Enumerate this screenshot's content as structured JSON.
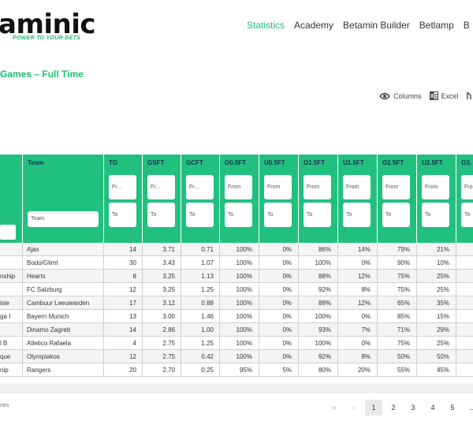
{
  "header": {
    "logo_text": "aminic",
    "tagline": "POWER TO YOUR BETS",
    "nav": [
      "Statistics",
      "Academy",
      "Betamin Builder",
      "Betlamp",
      "B"
    ],
    "active_nav": "Statistics"
  },
  "subtitle": "Games – Full Time",
  "tools": {
    "columns_label": "Columns",
    "excel_label": "Excel"
  },
  "table": {
    "columns": [
      "Team",
      "TG",
      "GSFT",
      "GCFT",
      "O0.5FT",
      "U0.5FT",
      "O1.5FT",
      "U1.5FT",
      "O2.5FT",
      "U2.5FT",
      "O3."
    ],
    "filter_from": "Fr...",
    "filter_from_full": "From",
    "filter_to": "To",
    "team_filter_placeholder": "Team",
    "rows": [
      {
        "league": "",
        "team": "Ajax",
        "tg": "14",
        "gsft": "3.71",
        "gcft": "0.71",
        "o05": "100%",
        "u05": "0%",
        "o15": "86%",
        "u15": "14%",
        "o25": "79%",
        "u25": "21%"
      },
      {
        "league": "",
        "team": "Bodo/Glimt",
        "tg": "30",
        "gsft": "3.43",
        "gcft": "1.07",
        "o05": "100%",
        "u05": "0%",
        "o15": "100%",
        "u15": "0%",
        "o25": "90%",
        "u25": "10%"
      },
      {
        "league": "nship",
        "team": "Hearts",
        "tg": "8",
        "gsft": "3.25",
        "gcft": "1.13",
        "o05": "100%",
        "u05": "0%",
        "o15": "88%",
        "u15": "12%",
        "o25": "75%",
        "u25": "25%"
      },
      {
        "league": "",
        "team": "FC Salzburg",
        "tg": "12",
        "gsft": "3.25",
        "gcft": "1.25",
        "o05": "100%",
        "u05": "0%",
        "o15": "92%",
        "u15": "8%",
        "o25": "75%",
        "u25": "25%"
      },
      {
        "league": "isie",
        "team": "Cambuur Leeuwarden",
        "tg": "17",
        "gsft": "3.12",
        "gcft": "0.88",
        "o05": "100%",
        "u05": "0%",
        "o15": "88%",
        "u15": "12%",
        "o25": "65%",
        "u25": "35%"
      },
      {
        "league": "ga I",
        "team": "Bayern Munich",
        "tg": "13",
        "gsft": "3.00",
        "gcft": "1.46",
        "o05": "100%",
        "u05": "0%",
        "o15": "100%",
        "u15": "0%",
        "o25": "85%",
        "u25": "15%"
      },
      {
        "league": "",
        "team": "Dinamo Zagreb",
        "tg": "14",
        "gsft": "2.86",
        "gcft": "1.00",
        "o05": "100%",
        "u05": "0%",
        "o15": "93%",
        "u15": "7%",
        "o25": "71%",
        "u25": "29%"
      },
      {
        "league": "l B",
        "team": "Atletico Rafaela",
        "tg": "4",
        "gsft": "2.75",
        "gcft": "1.25",
        "o05": "100%",
        "u05": "0%",
        "o15": "100%",
        "u15": "0%",
        "o25": "75%",
        "u25": "25%"
      },
      {
        "league": "que",
        "team": "Olympiakos",
        "tg": "12",
        "gsft": "2.75",
        "gcft": "0.42",
        "o05": "100%",
        "u05": "0%",
        "o15": "92%",
        "u15": "8%",
        "o25": "50%",
        "u25": "50%"
      },
      {
        "league": "nip",
        "team": "Rangers",
        "tg": "20",
        "gsft": "2.70",
        "gcft": "0.25",
        "o05": "95%",
        "u05": "5%",
        "o15": "80%",
        "u15": "20%",
        "o25": "55%",
        "u25": "45%"
      }
    ]
  },
  "footer": {
    "info": "ries",
    "pages": [
      "1",
      "2",
      "3",
      "4",
      "5",
      "..."
    ],
    "active_page": "1",
    "first_label": "«",
    "prev_label": "‹"
  }
}
